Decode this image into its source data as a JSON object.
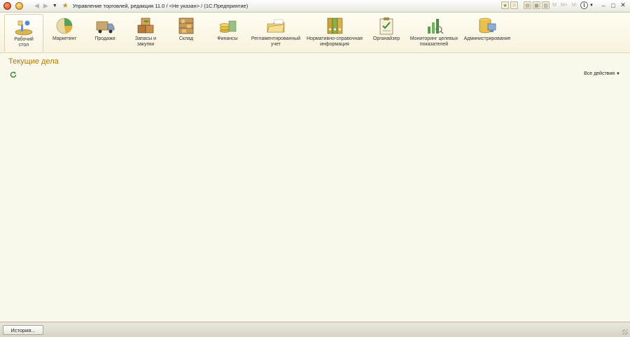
{
  "window": {
    "title": "Управление торговлей, редакция 11.0 / <Не указан> / (1С:Предприятие)",
    "m_labels": [
      "M",
      "M+",
      "M-"
    ]
  },
  "sections": [
    {
      "id": "desktop",
      "label": "Рабочий\nстол",
      "icon": "desktop-icon",
      "active": true
    },
    {
      "id": "marketing",
      "label": "Маркетинг",
      "icon": "marketing-icon",
      "active": false
    },
    {
      "id": "sales",
      "label": "Продажи",
      "icon": "sales-truck-icon",
      "active": false
    },
    {
      "id": "stocks",
      "label": "Запасы и\nзакупки",
      "icon": "stocks-boxes-icon",
      "active": false
    },
    {
      "id": "warehouse",
      "label": "Склад",
      "icon": "warehouse-shelf-icon",
      "active": false
    },
    {
      "id": "finance",
      "label": "Финансы",
      "icon": "finance-coins-icon",
      "active": false
    },
    {
      "id": "regulated",
      "label": "Регламентированный\nучет",
      "icon": "regulated-folder-icon",
      "active": false
    },
    {
      "id": "reference",
      "label": "Нормативно-справочная\nинформация",
      "icon": "reference-binders-icon",
      "active": false
    },
    {
      "id": "organizer",
      "label": "Органайзер",
      "icon": "organizer-clipboard-icon",
      "active": false
    },
    {
      "id": "monitoring",
      "label": "Мониторинг целевых\nпоказателей",
      "icon": "monitoring-chart-icon",
      "active": false
    },
    {
      "id": "admin",
      "label": "Администрирование",
      "icon": "admin-database-icon",
      "active": false
    }
  ],
  "main": {
    "title": "Текущие дела",
    "all_actions": "Все действия"
  },
  "footer": {
    "history_label": "История..."
  },
  "colors": {
    "background": "#faf8ea",
    "title_accent": "#b27a00"
  }
}
